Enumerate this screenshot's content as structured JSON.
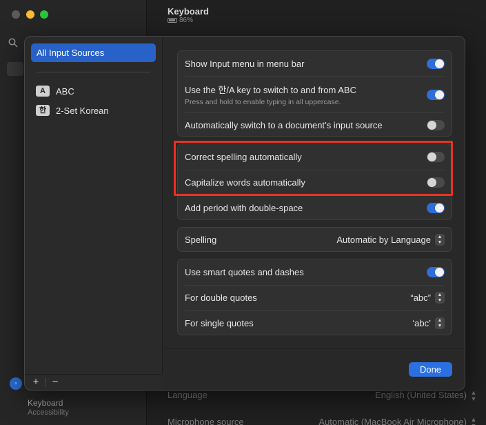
{
  "background": {
    "window_title": "Keyboard",
    "battery": "86%",
    "sidebar_bottom_title": "Keyboard",
    "sidebar_bottom_subtitle": "Accessibility",
    "rows": [
      {
        "label": "Language",
        "value": "English (United States)"
      },
      {
        "label": "Microphone source",
        "value": "Automatic (MacBook Air Microphone)"
      }
    ]
  },
  "sheet": {
    "sources": {
      "selected_label": "All Input Sources",
      "items": [
        {
          "badge": "A",
          "label": "ABC"
        },
        {
          "badge": "한",
          "label": "2-Set Korean"
        }
      ],
      "add_label": "+",
      "remove_label": "−"
    },
    "group1": {
      "show_input_menu": {
        "label": "Show Input menu in menu bar",
        "on": true
      },
      "han_key": {
        "label": "Use the 한/A key to switch to and from ABC",
        "sublabel": "Press and hold to enable typing in all uppercase.",
        "on": true
      },
      "auto_switch": {
        "label": "Automatically switch to a document’s input source",
        "on": false
      }
    },
    "group2": {
      "correct_spelling": {
        "label": "Correct spelling automatically",
        "on": false
      },
      "capitalize": {
        "label": "Capitalize words automatically",
        "on": false
      },
      "add_period": {
        "label": "Add period with double-space",
        "on": true
      }
    },
    "spelling": {
      "label": "Spelling",
      "value": "Automatic by Language"
    },
    "group3": {
      "smart_quotes": {
        "label": "Use smart quotes and dashes",
        "on": true
      },
      "double_quotes": {
        "label": "For double quotes",
        "value": "“abc”"
      },
      "single_quotes": {
        "label": "For single quotes",
        "value": "‘abc’"
      }
    },
    "done_label": "Done"
  },
  "colors": {
    "accent": "#2f6ed8",
    "highlight": "#e8331f"
  }
}
